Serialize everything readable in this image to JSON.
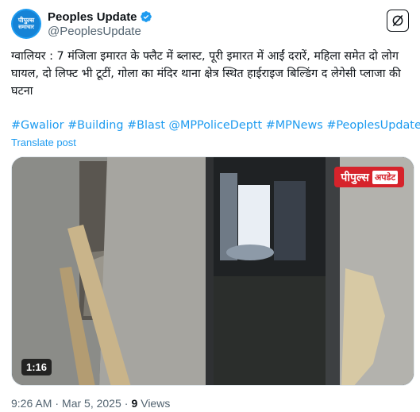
{
  "author": {
    "avatar_line1": "पीपुल्स",
    "avatar_line2": "समाचार",
    "display_name": "Peoples Update",
    "handle": "@PeoplesUpdate",
    "verified": true
  },
  "tweet": {
    "text": "ग्वालियर : 7 मंजिला इमारत के फ्लैट में ब्लास्ट, पूरी इमारत में आईं दरारें, महिला समेत दो लोग घायल, दो लिफ्ट भी टूटीं, गोला का मंदिर थाना क्षेत्र स्थित हाईराइज बिल्डिंग द लेगेसी प्लाजा की घटना",
    "hashtags": "#Gwalior #Building #Blast @MPPoliceDeptt #MPNews #PeoplesUpdate",
    "translate_label": "Translate post"
  },
  "media": {
    "brand_badge_main": "पीपुल्स",
    "brand_badge_sub": "अपडेट",
    "duration": "1:16"
  },
  "meta": {
    "time": "9:26 AM",
    "separator": "·",
    "date": "Mar 5, 2025",
    "views_count": "9",
    "views_label": "Views"
  },
  "colors": {
    "accent": "#1d9bf0",
    "text": "#0f1419",
    "secondary": "#536471",
    "badge_red": "#d6232b"
  },
  "icons": {
    "verified": "verified-badge-icon",
    "grok": "grok-icon"
  }
}
